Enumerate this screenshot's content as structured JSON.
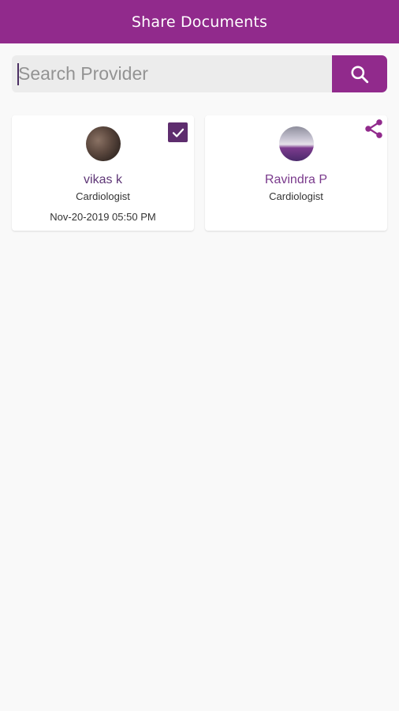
{
  "header": {
    "title": "Share Documents"
  },
  "colors": {
    "primary": "#912a8c",
    "checkbox": "#5e2d6e",
    "background": "#f9f9f9"
  },
  "search": {
    "placeholder": "Search Provider",
    "value": "",
    "button_icon": "search-icon"
  },
  "providers": [
    {
      "name": "vikas k",
      "specialty": "Cardiologist",
      "date": "Nov-20-2019 05:50 PM",
      "selected": true,
      "action_icon": "checkbox-checked-icon"
    },
    {
      "name": "Ravindra P",
      "specialty": "Cardiologist",
      "date": "",
      "selected": false,
      "action_icon": "share-icon"
    }
  ]
}
